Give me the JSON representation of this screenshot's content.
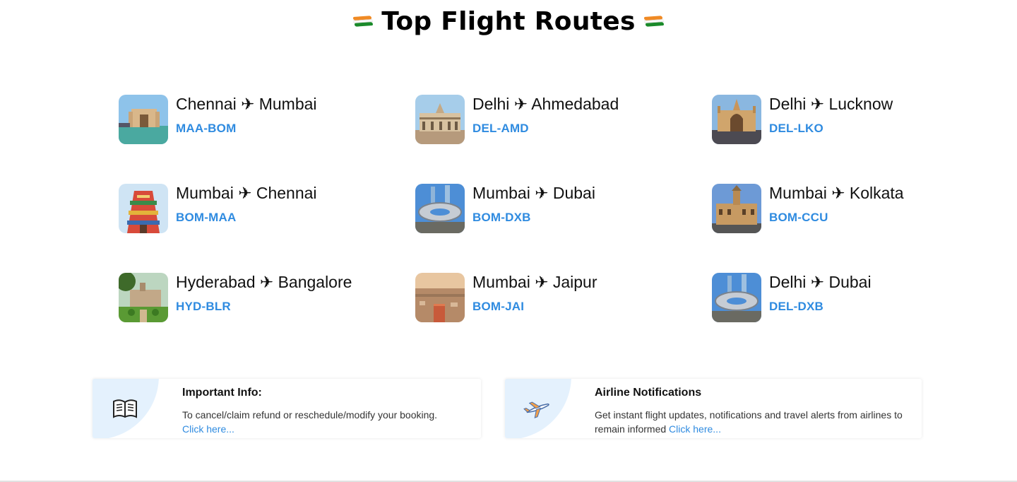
{
  "header": {
    "title": "Top Flight Routes",
    "flag_icon": "india-flag-icon"
  },
  "routes": [
    {
      "name": "Chennai ✈ Mumbai",
      "code": "MAA-BOM",
      "image": "gateway-of-india-thumbnail"
    },
    {
      "name": "Delhi ✈ Ahmedabad",
      "code": "DEL-AMD",
      "image": "ahmedabad-monument-thumbnail"
    },
    {
      "name": "Delhi ✈ Lucknow",
      "code": "DEL-LKO",
      "image": "rumi-darwaza-thumbnail"
    },
    {
      "name": "Mumbai ✈ Chennai",
      "code": "BOM-MAA",
      "image": "chennai-temple-thumbnail"
    },
    {
      "name": "Mumbai ✈ Dubai",
      "code": "BOM-DXB",
      "image": "museum-of-future-thumbnail"
    },
    {
      "name": "Mumbai ✈ Kolkata",
      "code": "BOM-CCU",
      "image": "kolkata-building-thumbnail"
    },
    {
      "name": "Hyderabad ✈ Bangalore",
      "code": "HYD-BLR",
      "image": "bangalore-palace-thumbnail"
    },
    {
      "name": "Mumbai ✈ Jaipur",
      "code": "BOM-JAI",
      "image": "jaipur-fort-thumbnail"
    },
    {
      "name": "Delhi ✈ Dubai",
      "code": "DEL-DXB",
      "image": "museum-of-future-thumbnail"
    }
  ],
  "info_cards": {
    "important": {
      "title": "Important Info:",
      "body": "To cancel/claim refund or reschedule/modify your booking.",
      "link": "Click here...",
      "icon": "book-icon"
    },
    "airline": {
      "title": "Airline Notifications",
      "body": "Get instant flight updates, notifications and travel alerts from airlines to remain informed",
      "link": "Click here...",
      "icon": "airplane-icon"
    }
  },
  "colors": {
    "accent": "#2f8be0",
    "card_blob": "#e4f1fd",
    "flag_saffron": "#f08a24",
    "flag_green": "#1a8a2a"
  }
}
